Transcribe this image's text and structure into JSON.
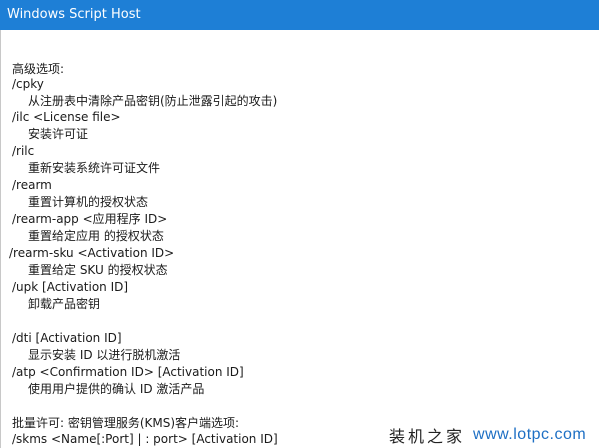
{
  "window": {
    "title": "Windows Script Host"
  },
  "lines": [
    "高级选项:",
    "/cpky",
    "从注册表中清除产品密钥(防止泄露引起的攻击)",
    "/ilc <License file>",
    "安装许可证",
    "/rilc",
    "重新安装系统许可证文件",
    "/rearm",
    "重置计算机的授权状态",
    "/rearm-app <应用程序 ID>",
    "重置给定应用 的授权状态",
    "/rearm-sku <Activation ID>",
    "重置给定 SKU 的授权状态",
    "/upk [Activation ID]",
    "卸载产品密钥",
    "/dti [Activation ID]",
    "显示安装 ID 以进行脱机激活",
    "/atp <Confirmation ID> [Activation ID]",
    "使用用户提供的确认 ID 激活产品",
    "批量许可: 密钥管理服务(KMS)客户端选项:",
    "/skms <Name[:Port] | : port> [Activation ID]"
  ],
  "watermark": {
    "brand": "装机之家",
    "url": "www.lotpc.com"
  }
}
